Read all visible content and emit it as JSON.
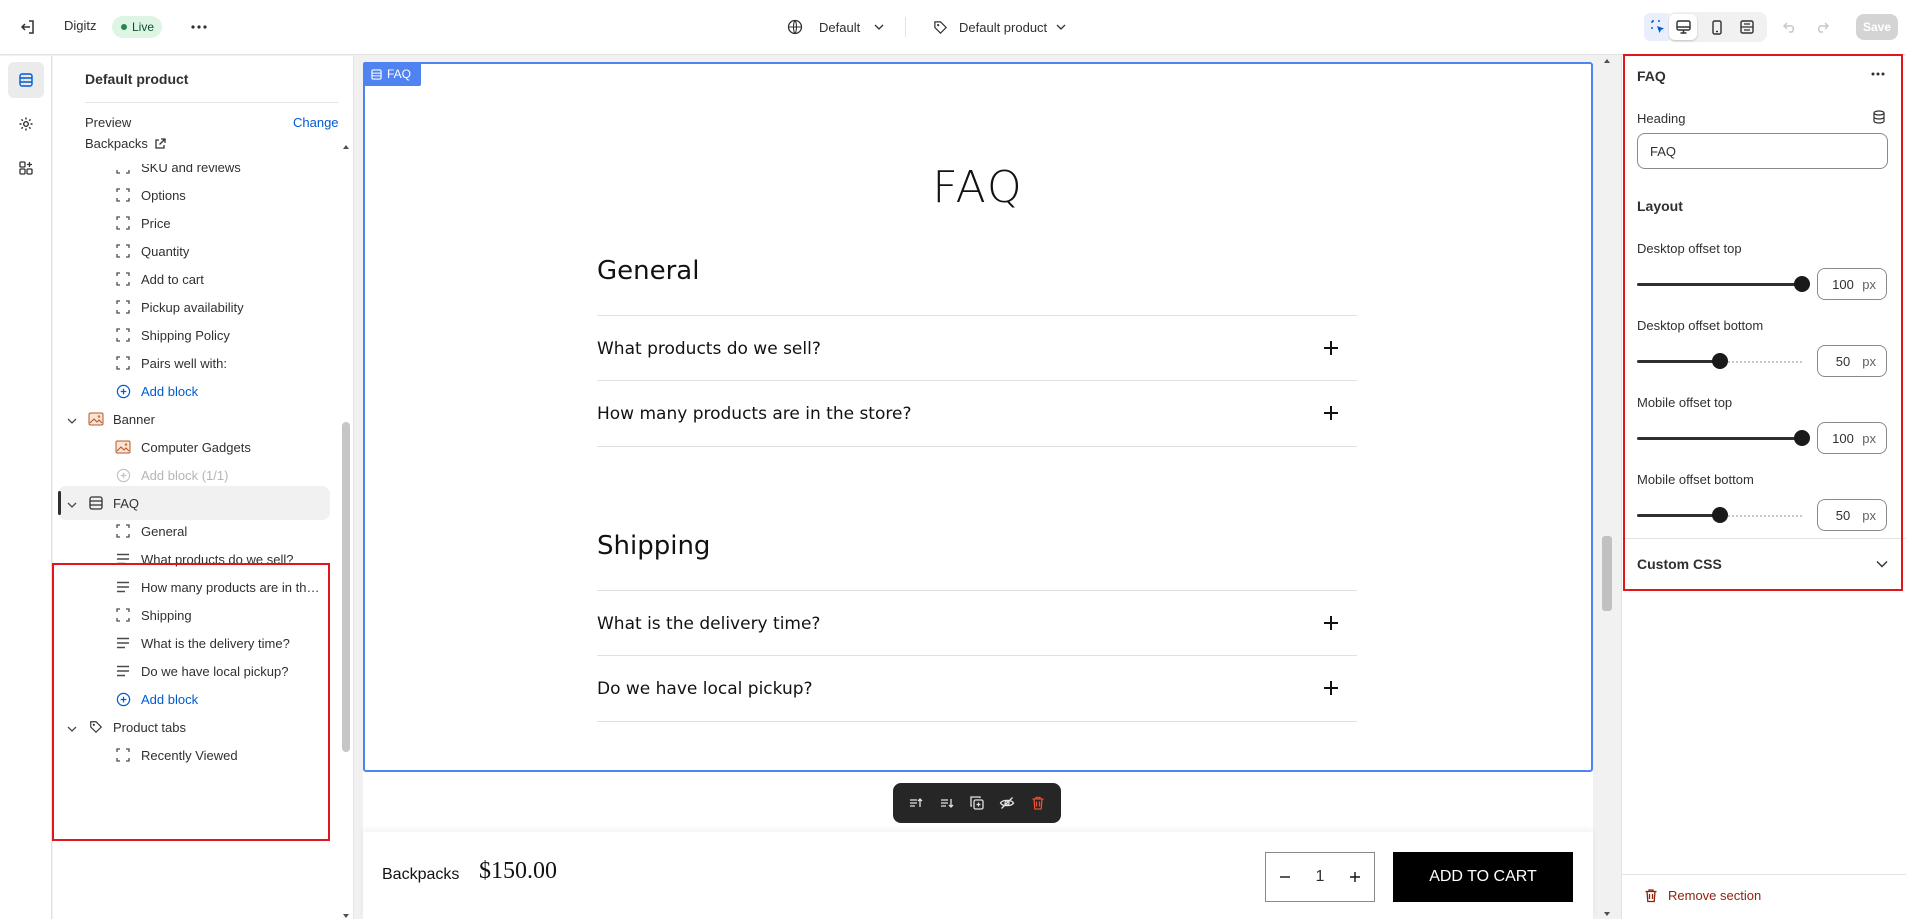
{
  "topbar": {
    "store_name": "Digitz",
    "status": "Live",
    "theme_selector": "Default",
    "template_selector": "Default product",
    "save_label": "Save"
  },
  "sidebar": {
    "title": "Default product",
    "preview_label": "Preview",
    "change_label": "Change",
    "preview_value": "Backpacks",
    "tree": [
      {
        "label": "SKU and reviews",
        "kind": "block",
        "icon": "block-icon"
      },
      {
        "label": "Options",
        "kind": "block",
        "icon": "block-icon"
      },
      {
        "label": "Price",
        "kind": "block",
        "icon": "block-icon"
      },
      {
        "label": "Quantity",
        "kind": "block",
        "icon": "block-icon"
      },
      {
        "label": "Add to cart",
        "kind": "block",
        "icon": "block-icon"
      },
      {
        "label": "Pickup availability",
        "kind": "block",
        "icon": "block-icon"
      },
      {
        "label": "Shipping Policy",
        "kind": "block",
        "icon": "block-icon"
      },
      {
        "label": "Pairs well with:",
        "kind": "block",
        "icon": "block-icon"
      },
      {
        "label": "Add block",
        "kind": "add",
        "icon": "add-circle-icon"
      },
      {
        "label": "Banner",
        "kind": "section",
        "icon": "image-icon"
      },
      {
        "label": "Computer Gadgets",
        "kind": "block",
        "icon": "image-icon"
      },
      {
        "label": "Add block (1/1)",
        "kind": "add-disabled",
        "icon": "add-circle-icon"
      },
      {
        "label": "FAQ",
        "kind": "section-active",
        "icon": "list-icon"
      },
      {
        "label": "General",
        "kind": "block",
        "icon": "block-icon"
      },
      {
        "label": "What products do we sell?",
        "kind": "block",
        "icon": "text-icon"
      },
      {
        "label": "How many products are in the store?",
        "kind": "block",
        "icon": "text-icon"
      },
      {
        "label": "Shipping",
        "kind": "block",
        "icon": "block-icon"
      },
      {
        "label": "What is the delivery time?",
        "kind": "block",
        "icon": "text-icon"
      },
      {
        "label": "Do we have local pickup?",
        "kind": "block",
        "icon": "text-icon"
      },
      {
        "label": "Add block",
        "kind": "add",
        "icon": "add-circle-icon"
      },
      {
        "label": "Product tabs",
        "kind": "section",
        "icon": "tag-icon"
      },
      {
        "label": "Recently Viewed",
        "kind": "block",
        "icon": "block-icon"
      }
    ]
  },
  "canvas": {
    "section_tag": "FAQ",
    "heading": "FAQ",
    "groups": [
      {
        "title": "General",
        "questions": [
          "What products do we sell?",
          "How many products are in the store?"
        ]
      },
      {
        "title": "Shipping",
        "questions": [
          "What is the delivery time?",
          "Do we have local pickup?"
        ]
      }
    ],
    "cart_bar": {
      "product": "Backpacks",
      "price": "$150.00",
      "quantity": "1",
      "add_to_cart": "ADD TO CART"
    }
  },
  "inspector": {
    "title": "FAQ",
    "heading_label": "Heading",
    "heading_value": "FAQ",
    "layout_label": "Layout",
    "sliders": [
      {
        "label": "Desktop offset top",
        "value": "100",
        "unit": "px",
        "fraction": 1.0
      },
      {
        "label": "Desktop offset bottom",
        "value": "50",
        "unit": "px",
        "fraction": 0.5
      },
      {
        "label": "Mobile offset top",
        "value": "100",
        "unit": "px",
        "fraction": 1.0
      },
      {
        "label": "Mobile offset bottom",
        "value": "50",
        "unit": "px",
        "fraction": 0.5
      }
    ],
    "custom_css_label": "Custom CSS",
    "remove_label": "Remove section"
  },
  "colors": {
    "accent": "#005bd3",
    "selection": "#4f83f2",
    "highlight_box": "#e0161b"
  }
}
